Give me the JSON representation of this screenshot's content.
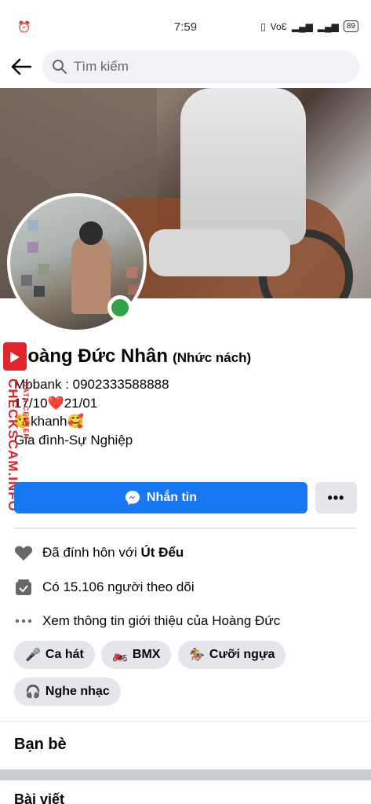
{
  "status_bar": {
    "time": "7:59",
    "alarm_icon": "alarm-clock-icon",
    "network": "VoƐ",
    "battery": "89"
  },
  "search": {
    "placeholder": "Tìm kiếm"
  },
  "profile": {
    "name": "Hoàng Đức Nhân",
    "nickname": "(Nhức nách)",
    "bio_lines": [
      "Mbbank : 0902333588888",
      "   17/10❤️21/01",
      "  😘khanh🥰",
      "Gia đình-Sự Nghiệp"
    ],
    "online": true
  },
  "watermark": {
    "main": "CHECKSCAM.INFO",
    "sub": "DATA CENTER"
  },
  "actions": {
    "message_label": "Nhắn tin",
    "more_label": "•••"
  },
  "info": {
    "relationship_prefix": "Đã đính hôn với ",
    "relationship_partner": "Út Đểu",
    "followers_text": "Có 15.106 người theo dõi",
    "about_text": "Xem thông tin giới thiệu của Hoàng Đức"
  },
  "hobbies": [
    {
      "emoji": "🎤",
      "label": "Ca hát"
    },
    {
      "emoji": "🏍️",
      "label": "BMX"
    },
    {
      "emoji": "🏇",
      "label": "Cưỡi ngựa"
    },
    {
      "emoji": "🎧",
      "label": "Nghe nhạc"
    }
  ],
  "sections": {
    "friends": "Bạn bè",
    "posts": "Bài viết"
  },
  "colors": {
    "accent": "#1877f2",
    "online": "#31a24c",
    "watermark": "#e0242b"
  }
}
